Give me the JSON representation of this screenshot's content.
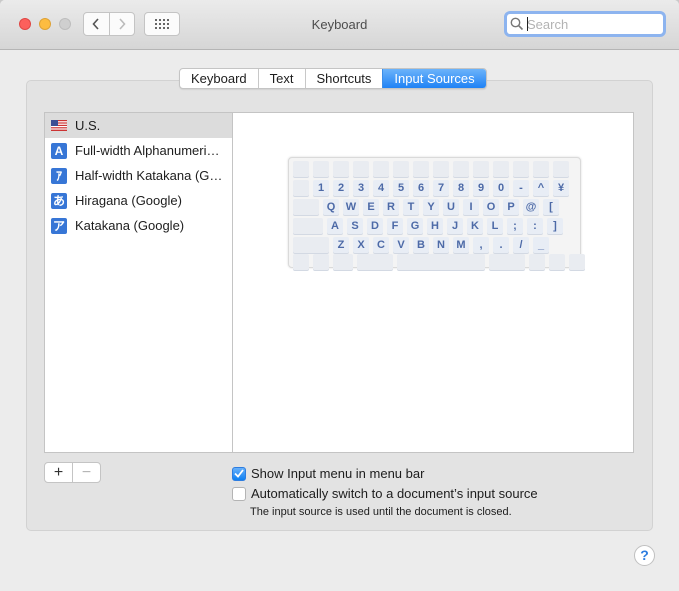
{
  "window": {
    "title": "Keyboard"
  },
  "search": {
    "placeholder": "Search",
    "value": ""
  },
  "tabs": [
    {
      "label": "Keyboard",
      "active": false
    },
    {
      "label": "Text",
      "active": false
    },
    {
      "label": "Shortcuts",
      "active": false
    },
    {
      "label": "Input Sources",
      "active": true
    }
  ],
  "sources": [
    {
      "label": "U.S.",
      "icon": "us-flag-icon",
      "glyph": "",
      "selected": true
    },
    {
      "label": "Full-width Alphanumeri…",
      "icon": "fullwidth-a-icon",
      "glyph": "A",
      "selected": false
    },
    {
      "label": "Half-width Katakana (G…",
      "icon": "halfwidth-katakana-icon",
      "glyph": "ｱ",
      "selected": false
    },
    {
      "label": "Hiragana (Google)",
      "icon": "hiragana-icon",
      "glyph": "あ",
      "selected": false
    },
    {
      "label": "Katakana (Google)",
      "icon": "katakana-icon",
      "glyph": "ア",
      "selected": false
    }
  ],
  "keyboard": {
    "row1": [
      "1",
      "2",
      "3",
      "4",
      "5",
      "6",
      "7",
      "8",
      "9",
      "0",
      "-",
      "^",
      "¥"
    ],
    "row2": [
      "Q",
      "W",
      "E",
      "R",
      "T",
      "Y",
      "U",
      "I",
      "O",
      "P",
      "@",
      "["
    ],
    "row3": [
      "A",
      "S",
      "D",
      "F",
      "G",
      "H",
      "J",
      "K",
      "L",
      ";",
      ":",
      "]"
    ],
    "row4": [
      "Z",
      "X",
      "C",
      "V",
      "B",
      "N",
      "M",
      ",",
      ".",
      "/",
      "_"
    ]
  },
  "buttons": {
    "add": "+",
    "remove": "−",
    "help": "?"
  },
  "options": {
    "show_input_menu": {
      "label": "Show Input menu in menu bar",
      "checked": true
    },
    "auto_switch": {
      "label": "Automatically switch to a document’s input source",
      "checked": false
    },
    "note": "The input source is used until the document is closed."
  },
  "colors": {
    "accent": "#1f82f5",
    "key_text": "#4d6aa7"
  }
}
